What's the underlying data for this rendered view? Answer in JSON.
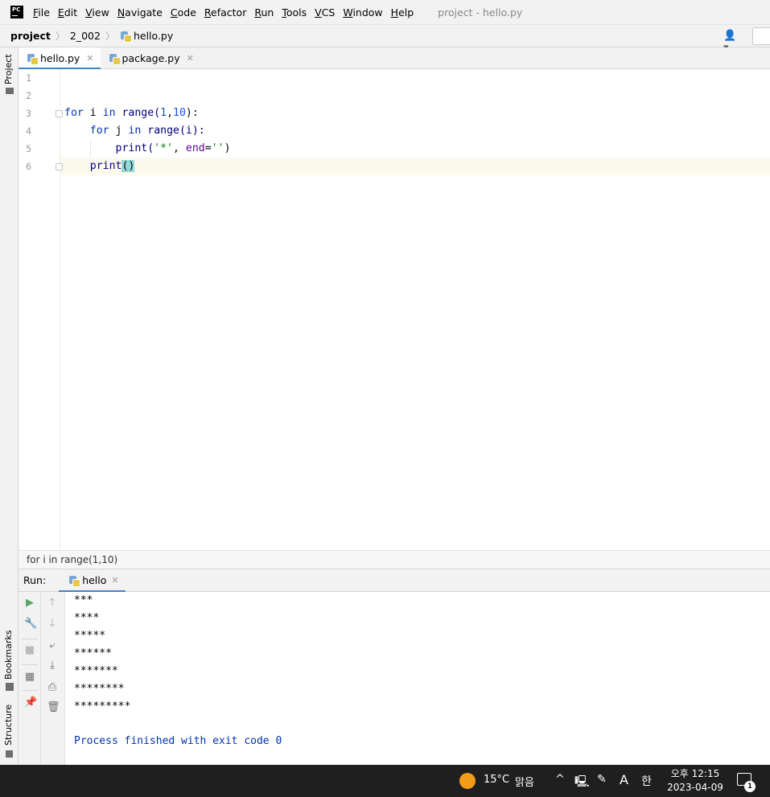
{
  "app": {
    "logo_text": "PC",
    "window_title": "project - hello.py"
  },
  "menu": [
    {
      "label": "File",
      "mnemonic": "F",
      "rest": "ile"
    },
    {
      "label": "Edit",
      "mnemonic": "E",
      "rest": "dit"
    },
    {
      "label": "View",
      "mnemonic": "V",
      "rest": "iew"
    },
    {
      "label": "Navigate",
      "mnemonic": "N",
      "rest": "avigate"
    },
    {
      "label": "Code",
      "mnemonic": "C",
      "rest": "ode"
    },
    {
      "label": "Refactor",
      "mnemonic": "R",
      "rest": "efactor"
    },
    {
      "label": "Run",
      "mnemonic": "R",
      "rest": "un"
    },
    {
      "label": "Tools",
      "mnemonic": "T",
      "rest": "ools"
    },
    {
      "label": "VCS",
      "mnemonic": "V",
      "rest": "CS"
    },
    {
      "label": "Window",
      "mnemonic": "W",
      "rest": "indow"
    },
    {
      "label": "Help",
      "mnemonic": "H",
      "rest": "elp"
    }
  ],
  "breadcrumb": {
    "project": "project",
    "folder": "2_002",
    "file": "hello.py"
  },
  "left_stripe": {
    "project": "Project",
    "bookmarks": "Bookmarks",
    "structure": "Structure"
  },
  "tabs": [
    {
      "label": "hello.py",
      "active": true
    },
    {
      "label": "package.py",
      "active": false
    }
  ],
  "editor": {
    "line_numbers": [
      "1",
      "2",
      "3",
      "4",
      "5",
      "6"
    ],
    "code": {
      "l3_for": "for",
      "l3_i": " i ",
      "l3_in": "in",
      "l3_range": " range(",
      "l3_1": "1",
      "l3_comma": ",",
      "l3_10": "10",
      "l3_end": "):",
      "l4_indent": "    ",
      "l4_for": "for",
      "l4_j": " j ",
      "l4_in": "in",
      "l4_rest": " range(i):",
      "l5_indent": "        ",
      "l5_print": "print(",
      "l5_str": "'*'",
      "l5_comma": ", ",
      "l5_end": "end",
      "l5_eq": "=",
      "l5_str2": "''",
      "l5_close": ")",
      "l6_indent": "    ",
      "l6_print": "print",
      "l6_parens": "()"
    }
  },
  "code_breadcrumb": "for i in range(1,10)",
  "run": {
    "label": "Run:",
    "tab": "hello",
    "output": [
      "***",
      "****",
      "*****",
      "******",
      "*******",
      "********",
      "*********"
    ],
    "exit_message": "Process finished with exit code 0"
  },
  "taskbar": {
    "temperature": "15°C",
    "weather": "맑음",
    "ime": "A",
    "lang": "한",
    "time": "오후 12:15",
    "date": "2023-04-09",
    "notifications": "1"
  },
  "colors": {
    "keyword": "#0033b3",
    "number": "#1750eb",
    "string": "#067d17",
    "named_arg": "#660099",
    "tab_underline": "#4083c9",
    "run_green": "#59a869"
  }
}
